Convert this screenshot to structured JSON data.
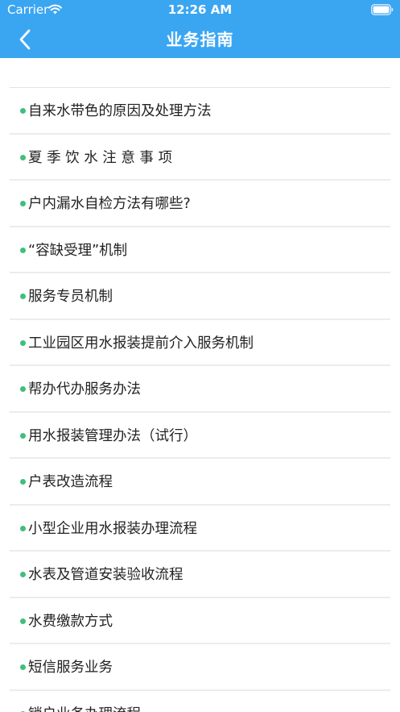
{
  "status_bar": {
    "carrier": "Carrier",
    "time": "12:26 AM",
    "wifi_icon": "wifi-icon",
    "battery_icon": "battery-icon"
  },
  "header": {
    "title": "业务指南",
    "back_icon": "chevron-left-icon",
    "background_color": "#3aa6f2"
  },
  "colors": {
    "bullet": "#3fbf7a",
    "divider": "#ececec"
  },
  "list": {
    "items": [
      {
        "label": "自来水带色的原因及处理方法"
      },
      {
        "label": "夏 季 饮 水 注 意 事 项"
      },
      {
        "label": "户内漏水自检方法有哪些?"
      },
      {
        "label": "“容缺受理”机制"
      },
      {
        "label": "服务专员机制"
      },
      {
        "label": "工业园区用水报装提前介入服务机制"
      },
      {
        "label": "帮办代办服务办法"
      },
      {
        "label": "用水报装管理办法（试行）"
      },
      {
        "label": "户表改造流程"
      },
      {
        "label": "小型企业用水报装办理流程"
      },
      {
        "label": "水表及管道安装验收流程"
      },
      {
        "label": "水费缴款方式"
      },
      {
        "label": "短信服务业务"
      },
      {
        "label": "销户业务办理流程"
      }
    ]
  }
}
